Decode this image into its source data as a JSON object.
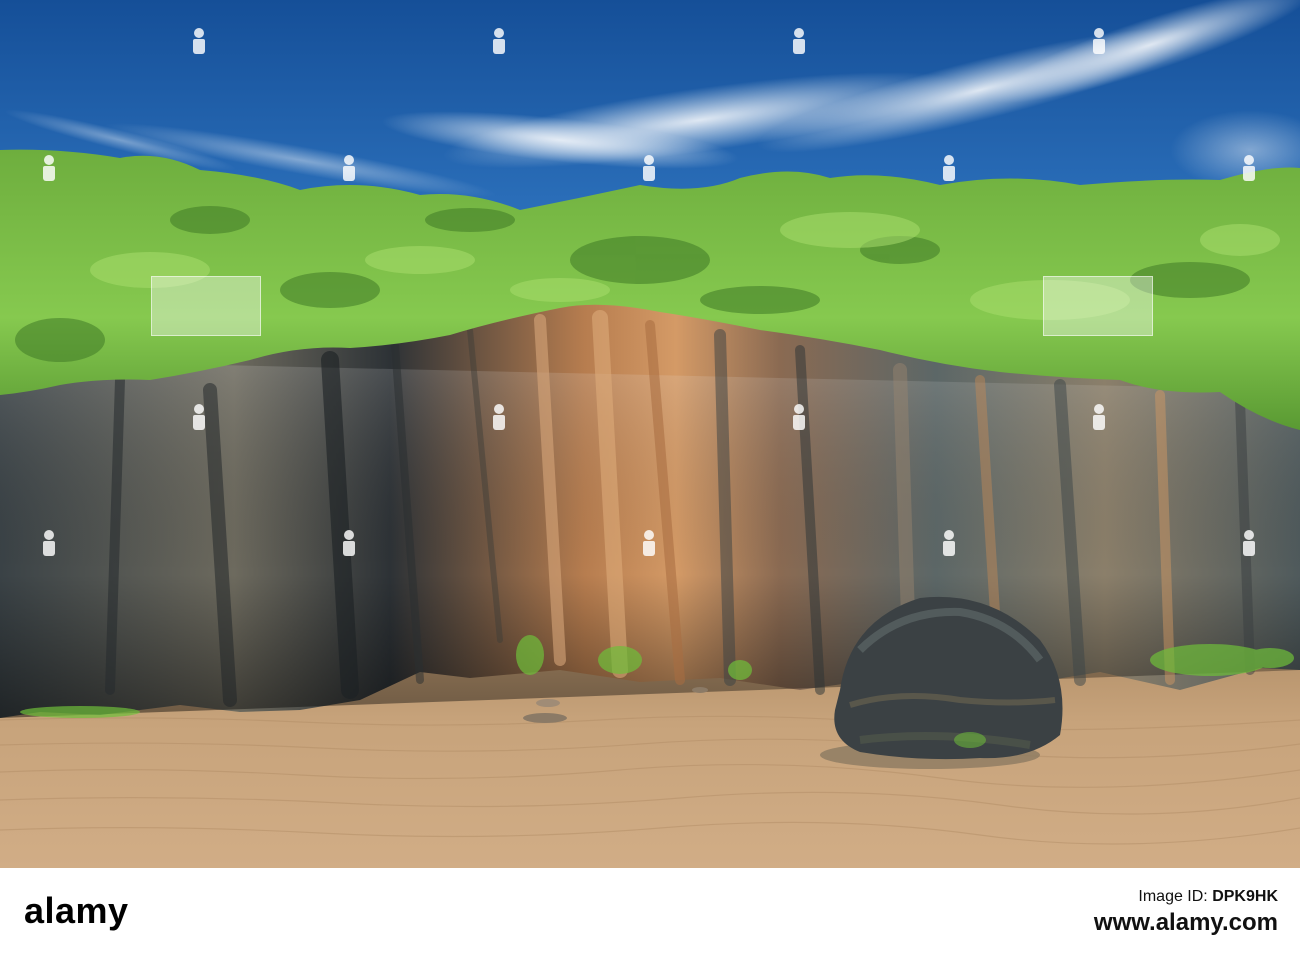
{
  "photo": {
    "subject": "coastal-cliff-with-grass-top-sandy-beach-and-rock-stack",
    "colors": {
      "sky_top": "#1d5ea8",
      "sky_bottom": "#4a8fd0",
      "cloud": "#ffffff",
      "grass": "#7cc24a",
      "grass_dark": "#4f8f2e",
      "rock_dark": "#2f3438",
      "rock_orange": "#c07a45",
      "rock_grey": "#7f8a86",
      "sand": "#c9a47c",
      "sand_shadow": "#b28e68",
      "pool": "#8c7a62"
    }
  },
  "footer": {
    "brand": "alamy",
    "image_id_label": "Image ID:",
    "image_id": "DPK9HK",
    "url": "www.alamy.com"
  }
}
